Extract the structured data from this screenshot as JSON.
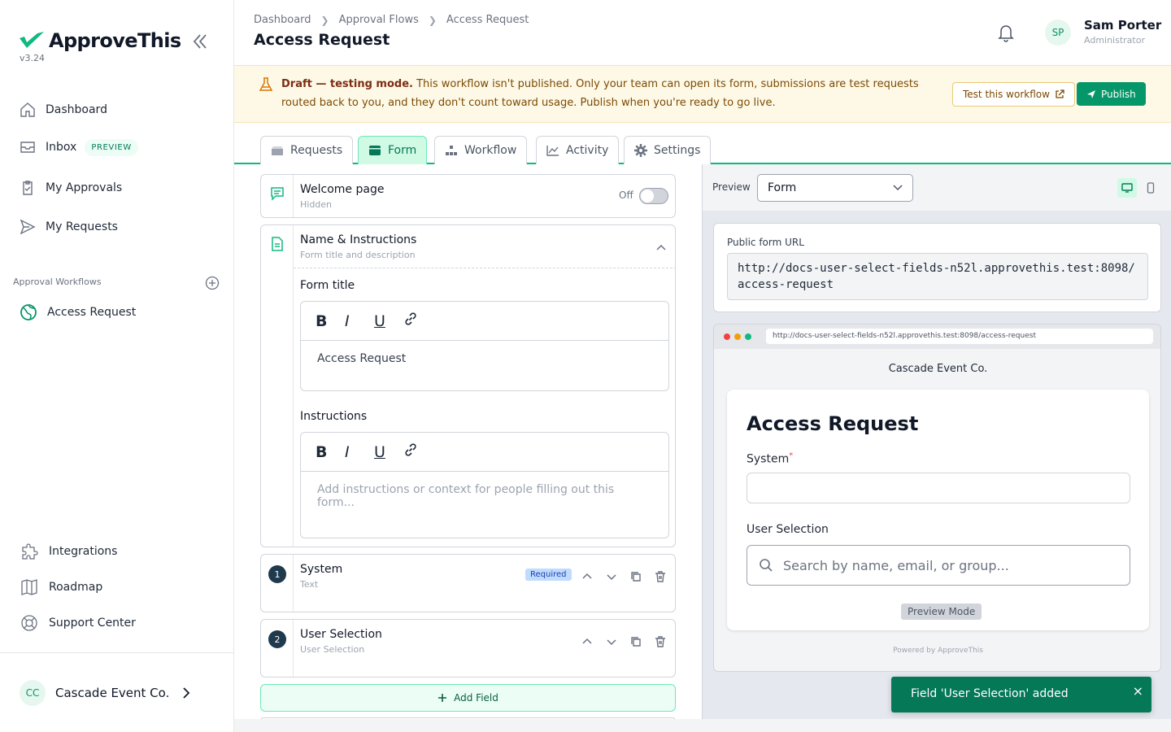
{
  "app": {
    "name": "ApproveThis",
    "version": "v3.24"
  },
  "sidebar": {
    "items": [
      {
        "label": "Dashboard",
        "icon": "home-icon"
      },
      {
        "label": "Inbox",
        "badge": "PREVIEW",
        "icon": "inbox-icon"
      },
      {
        "label": "My Approvals",
        "icon": "clipboard-icon"
      },
      {
        "label": "My Requests",
        "icon": "send-icon"
      }
    ],
    "section_label": "Approval Workflows",
    "workflows": [
      {
        "label": "Access Request",
        "icon": "globe-icon"
      }
    ],
    "bottom": [
      {
        "label": "Integrations",
        "icon": "puzzle-icon"
      },
      {
        "label": "Roadmap",
        "icon": "map-icon"
      },
      {
        "label": "Support Center",
        "icon": "lifebuoy-icon"
      }
    ],
    "org": {
      "initials": "CC",
      "name": "Cascade Event Co."
    }
  },
  "header": {
    "breadcrumbs": [
      "Dashboard",
      "Approval Flows",
      "Access Request"
    ],
    "title": "Access Request",
    "user": {
      "initials": "SP",
      "name": "Sam Porter",
      "role": "Administrator"
    }
  },
  "banner": {
    "strong": "Draft — testing mode.",
    "text": " This workflow isn't published. Only your team can open its form, submissions are test requests routed back to you, and they don't count toward usage. Publish when you're ready to go live.",
    "test_label": "Test this workflow",
    "publish_label": "Publish"
  },
  "tabs": [
    {
      "label": "Requests",
      "icon": "inbox-tray-icon",
      "active": false
    },
    {
      "label": "Form",
      "icon": "form-icon",
      "active": true
    },
    {
      "label": "Workflow",
      "icon": "workflow-icon",
      "active": false
    },
    {
      "label": "Activity",
      "icon": "chart-line-icon",
      "active": false
    },
    {
      "label": "Settings",
      "icon": "gear-icon",
      "active": false
    }
  ],
  "builder": {
    "welcome": {
      "title": "Welcome page",
      "subtitle": "Hidden",
      "toggle_label": "Off",
      "enabled": false
    },
    "name_instructions": {
      "title": "Name & Instructions",
      "subtitle": "Form title and description",
      "form_title_label": "Form title",
      "form_title_value": "Access Request",
      "instructions_label": "Instructions",
      "instructions_placeholder": "Add instructions or context for people filling out this form..."
    },
    "editor_tools": [
      "B",
      "I",
      "U"
    ],
    "fields": [
      {
        "number": "1",
        "title": "System",
        "type": "Text",
        "required_badge": "Required"
      },
      {
        "number": "2",
        "title": "User Selection",
        "type": "User Selection"
      }
    ],
    "add_field_label": "Add Field"
  },
  "preview": {
    "label": "Preview",
    "mode": "Form",
    "url_label": "Public form URL",
    "url": "http://docs-user-select-fields-n52l.approvethis.test:8098/access-request",
    "browser_url": "http://docs-user-select-fields-n52l.approvethis.test:8098/access-request",
    "company": "Cascade Event Co.",
    "form_title": "Access Request",
    "field1_label": "System",
    "field1_required_mark": "*",
    "field2_label": "User Selection",
    "search_placeholder": "Search by name, email, or group...",
    "preview_mode_label": "Preview Mode",
    "powered_by": "Powered by ApproveThis"
  },
  "toast": {
    "message": "Field 'User Selection' added",
    "close": "×"
  },
  "colors": {
    "brand": "#10b981",
    "brand_dark": "#059669",
    "banner_bg": "#fef9e7",
    "toast_bg": "#047857"
  }
}
